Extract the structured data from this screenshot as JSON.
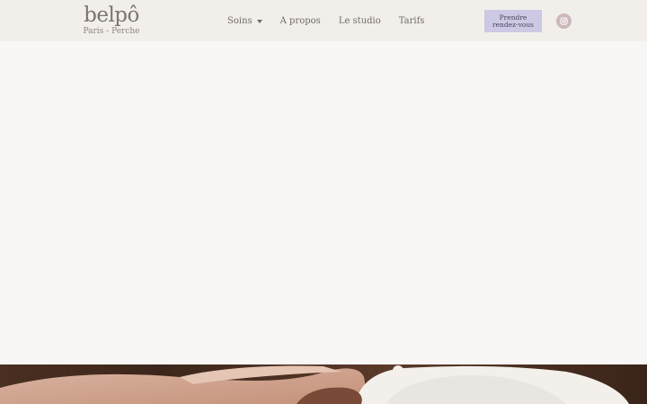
{
  "brand": {
    "name": "belpô",
    "tagline": "Paris - Perche"
  },
  "nav": {
    "items": [
      {
        "label": "Soins",
        "has_dropdown": true
      },
      {
        "label": "A propos"
      },
      {
        "label": "Le studio"
      },
      {
        "label": "Tarifs"
      }
    ]
  },
  "cta": {
    "line1": "Prendre",
    "line2": "rendez-vous"
  },
  "social": {
    "icon": "instagram-icon"
  },
  "colors": {
    "header_bg": "#f2efeb",
    "page_bg": "#f9f7f5",
    "cta_bg": "#cdc8e3",
    "social_bg": "#cdb8bb"
  }
}
